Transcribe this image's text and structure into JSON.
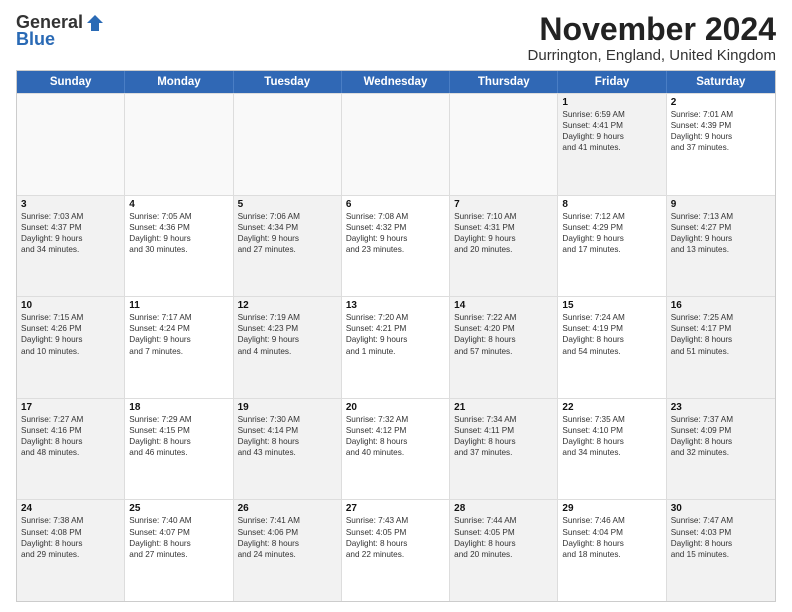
{
  "header": {
    "logo_general": "General",
    "logo_blue": "Blue",
    "month_title": "November 2024",
    "location": "Durrington, England, United Kingdom"
  },
  "days_of_week": [
    "Sunday",
    "Monday",
    "Tuesday",
    "Wednesday",
    "Thursday",
    "Friday",
    "Saturday"
  ],
  "rows": [
    [
      {
        "day": "",
        "info": "",
        "empty": true
      },
      {
        "day": "",
        "info": "",
        "empty": true
      },
      {
        "day": "",
        "info": "",
        "empty": true
      },
      {
        "day": "",
        "info": "",
        "empty": true
      },
      {
        "day": "",
        "info": "",
        "empty": true
      },
      {
        "day": "1",
        "info": "Sunrise: 6:59 AM\nSunset: 4:41 PM\nDaylight: 9 hours\nand 41 minutes.",
        "shaded": true
      },
      {
        "day": "2",
        "info": "Sunrise: 7:01 AM\nSunset: 4:39 PM\nDaylight: 9 hours\nand 37 minutes.",
        "shaded": false
      }
    ],
    [
      {
        "day": "3",
        "info": "Sunrise: 7:03 AM\nSunset: 4:37 PM\nDaylight: 9 hours\nand 34 minutes.",
        "shaded": true
      },
      {
        "day": "4",
        "info": "Sunrise: 7:05 AM\nSunset: 4:36 PM\nDaylight: 9 hours\nand 30 minutes.",
        "shaded": false
      },
      {
        "day": "5",
        "info": "Sunrise: 7:06 AM\nSunset: 4:34 PM\nDaylight: 9 hours\nand 27 minutes.",
        "shaded": true
      },
      {
        "day": "6",
        "info": "Sunrise: 7:08 AM\nSunset: 4:32 PM\nDaylight: 9 hours\nand 23 minutes.",
        "shaded": false
      },
      {
        "day": "7",
        "info": "Sunrise: 7:10 AM\nSunset: 4:31 PM\nDaylight: 9 hours\nand 20 minutes.",
        "shaded": true
      },
      {
        "day": "8",
        "info": "Sunrise: 7:12 AM\nSunset: 4:29 PM\nDaylight: 9 hours\nand 17 minutes.",
        "shaded": false
      },
      {
        "day": "9",
        "info": "Sunrise: 7:13 AM\nSunset: 4:27 PM\nDaylight: 9 hours\nand 13 minutes.",
        "shaded": true
      }
    ],
    [
      {
        "day": "10",
        "info": "Sunrise: 7:15 AM\nSunset: 4:26 PM\nDaylight: 9 hours\nand 10 minutes.",
        "shaded": true
      },
      {
        "day": "11",
        "info": "Sunrise: 7:17 AM\nSunset: 4:24 PM\nDaylight: 9 hours\nand 7 minutes.",
        "shaded": false
      },
      {
        "day": "12",
        "info": "Sunrise: 7:19 AM\nSunset: 4:23 PM\nDaylight: 9 hours\nand 4 minutes.",
        "shaded": true
      },
      {
        "day": "13",
        "info": "Sunrise: 7:20 AM\nSunset: 4:21 PM\nDaylight: 9 hours\nand 1 minute.",
        "shaded": false
      },
      {
        "day": "14",
        "info": "Sunrise: 7:22 AM\nSunset: 4:20 PM\nDaylight: 8 hours\nand 57 minutes.",
        "shaded": true
      },
      {
        "day": "15",
        "info": "Sunrise: 7:24 AM\nSunset: 4:19 PM\nDaylight: 8 hours\nand 54 minutes.",
        "shaded": false
      },
      {
        "day": "16",
        "info": "Sunrise: 7:25 AM\nSunset: 4:17 PM\nDaylight: 8 hours\nand 51 minutes.",
        "shaded": true
      }
    ],
    [
      {
        "day": "17",
        "info": "Sunrise: 7:27 AM\nSunset: 4:16 PM\nDaylight: 8 hours\nand 48 minutes.",
        "shaded": true
      },
      {
        "day": "18",
        "info": "Sunrise: 7:29 AM\nSunset: 4:15 PM\nDaylight: 8 hours\nand 46 minutes.",
        "shaded": false
      },
      {
        "day": "19",
        "info": "Sunrise: 7:30 AM\nSunset: 4:14 PM\nDaylight: 8 hours\nand 43 minutes.",
        "shaded": true
      },
      {
        "day": "20",
        "info": "Sunrise: 7:32 AM\nSunset: 4:12 PM\nDaylight: 8 hours\nand 40 minutes.",
        "shaded": false
      },
      {
        "day": "21",
        "info": "Sunrise: 7:34 AM\nSunset: 4:11 PM\nDaylight: 8 hours\nand 37 minutes.",
        "shaded": true
      },
      {
        "day": "22",
        "info": "Sunrise: 7:35 AM\nSunset: 4:10 PM\nDaylight: 8 hours\nand 34 minutes.",
        "shaded": false
      },
      {
        "day": "23",
        "info": "Sunrise: 7:37 AM\nSunset: 4:09 PM\nDaylight: 8 hours\nand 32 minutes.",
        "shaded": true
      }
    ],
    [
      {
        "day": "24",
        "info": "Sunrise: 7:38 AM\nSunset: 4:08 PM\nDaylight: 8 hours\nand 29 minutes.",
        "shaded": true
      },
      {
        "day": "25",
        "info": "Sunrise: 7:40 AM\nSunset: 4:07 PM\nDaylight: 8 hours\nand 27 minutes.",
        "shaded": false
      },
      {
        "day": "26",
        "info": "Sunrise: 7:41 AM\nSunset: 4:06 PM\nDaylight: 8 hours\nand 24 minutes.",
        "shaded": true
      },
      {
        "day": "27",
        "info": "Sunrise: 7:43 AM\nSunset: 4:05 PM\nDaylight: 8 hours\nand 22 minutes.",
        "shaded": false
      },
      {
        "day": "28",
        "info": "Sunrise: 7:44 AM\nSunset: 4:05 PM\nDaylight: 8 hours\nand 20 minutes.",
        "shaded": true
      },
      {
        "day": "29",
        "info": "Sunrise: 7:46 AM\nSunset: 4:04 PM\nDaylight: 8 hours\nand 18 minutes.",
        "shaded": false
      },
      {
        "day": "30",
        "info": "Sunrise: 7:47 AM\nSunset: 4:03 PM\nDaylight: 8 hours\nand 15 minutes.",
        "shaded": true
      }
    ]
  ]
}
